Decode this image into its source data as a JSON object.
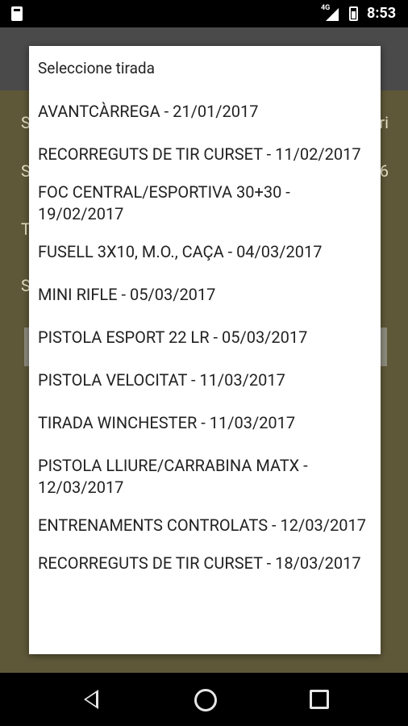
{
  "status_bar": {
    "network": "4G",
    "time": "8:53"
  },
  "background": {
    "row1_left": "S",
    "row1_right": "ri",
    "row2_left": "S",
    "row2_right": "6",
    "row3_left": "T",
    "row4_left": "S"
  },
  "dialog": {
    "title": "Seleccione tirada",
    "items": [
      "AVANTCÀRREGA - 21/01/2017",
      "RECORREGUTS DE TIR CURSET - 11/02/2017",
      "FOC CENTRAL/ESPORTIVA 30+30 - 19/02/2017",
      "FUSELL 3X10, M.O., CAÇA - 04/03/2017",
      "MINI RIFLE - 05/03/2017",
      "PISTOLA ESPORT 22 LR - 05/03/2017",
      "PISTOLA VELOCITAT - 11/03/2017",
      "TIRADA WINCHESTER - 11/03/2017",
      "PISTOLA LLIURE/CARRABINA MATX - 12/03/2017",
      "ENTRENAMENTS CONTROLATS - 12/03/2017",
      "RECORREGUTS DE TIR CURSET - 18/03/2017"
    ]
  },
  "nav": {
    "back_icon": "back-triangle",
    "home_icon": "home-circle",
    "recents_icon": "recents-square"
  }
}
